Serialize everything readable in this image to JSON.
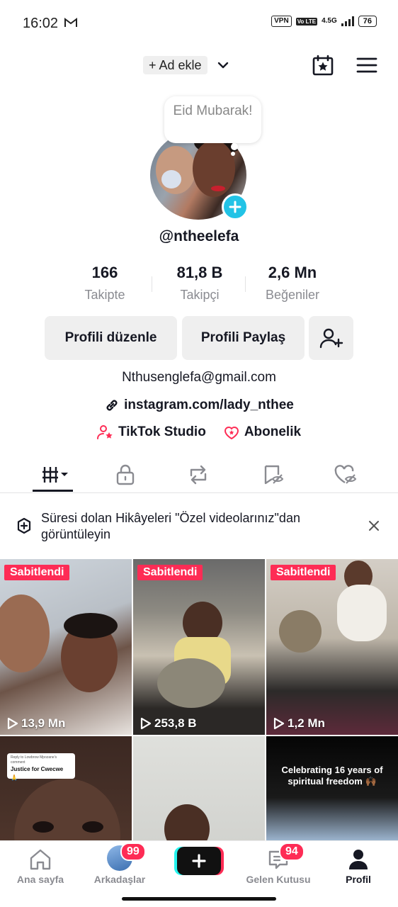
{
  "status_bar": {
    "time": "16:02",
    "vpn": "VPN",
    "volte": "Vo LTE",
    "network": "4.5G",
    "battery": "76"
  },
  "header": {
    "add_name": "+ Ad ekle"
  },
  "profile": {
    "note": "Eid Mubarak!",
    "username": "@ntheelefa",
    "stats": [
      {
        "value": "166",
        "label": "Takipte"
      },
      {
        "value": "81,8 B",
        "label": "Takipçi"
      },
      {
        "value": "2,6 Mn",
        "label": "Beğeniler"
      }
    ],
    "buttons": {
      "edit": "Profili düzenle",
      "share": "Profili Paylaş"
    },
    "email": "Nthusenglefa@gmail.com",
    "link": "instagram.com/lady_nthee",
    "shortcuts": [
      "TikTok Studio",
      "Abonelik"
    ]
  },
  "banner": {
    "text": "Süresi dolan Hikâyeleri \"Özel videolarınız\"dan görüntüleyin"
  },
  "videos": [
    {
      "pinned": "Sabitlendi",
      "views": "13,9 Mn"
    },
    {
      "pinned": "Sabitlendi",
      "views": "253,8 B"
    },
    {
      "pinned": "Sabitlendi",
      "views": "1,2 Mn"
    },
    {
      "reply_small": "Reply to Lowbrow Mpozane's comment",
      "reply_main": "Justice for Cwecwe 🙏"
    },
    {},
    {
      "caption": "Celebrating 16 years of spiritual freedom 🙌🏾"
    }
  ],
  "bottom_nav": {
    "home": "Ana sayfa",
    "friends": "Arkadaşlar",
    "friends_badge": "99",
    "inbox": "Gelen Kutusu",
    "inbox_badge": "94",
    "profile": "Profil"
  },
  "colors": {
    "accent": "#fe2c55",
    "cyan": "#22c3e6",
    "tiktok_cyan": "#25f4ee"
  }
}
